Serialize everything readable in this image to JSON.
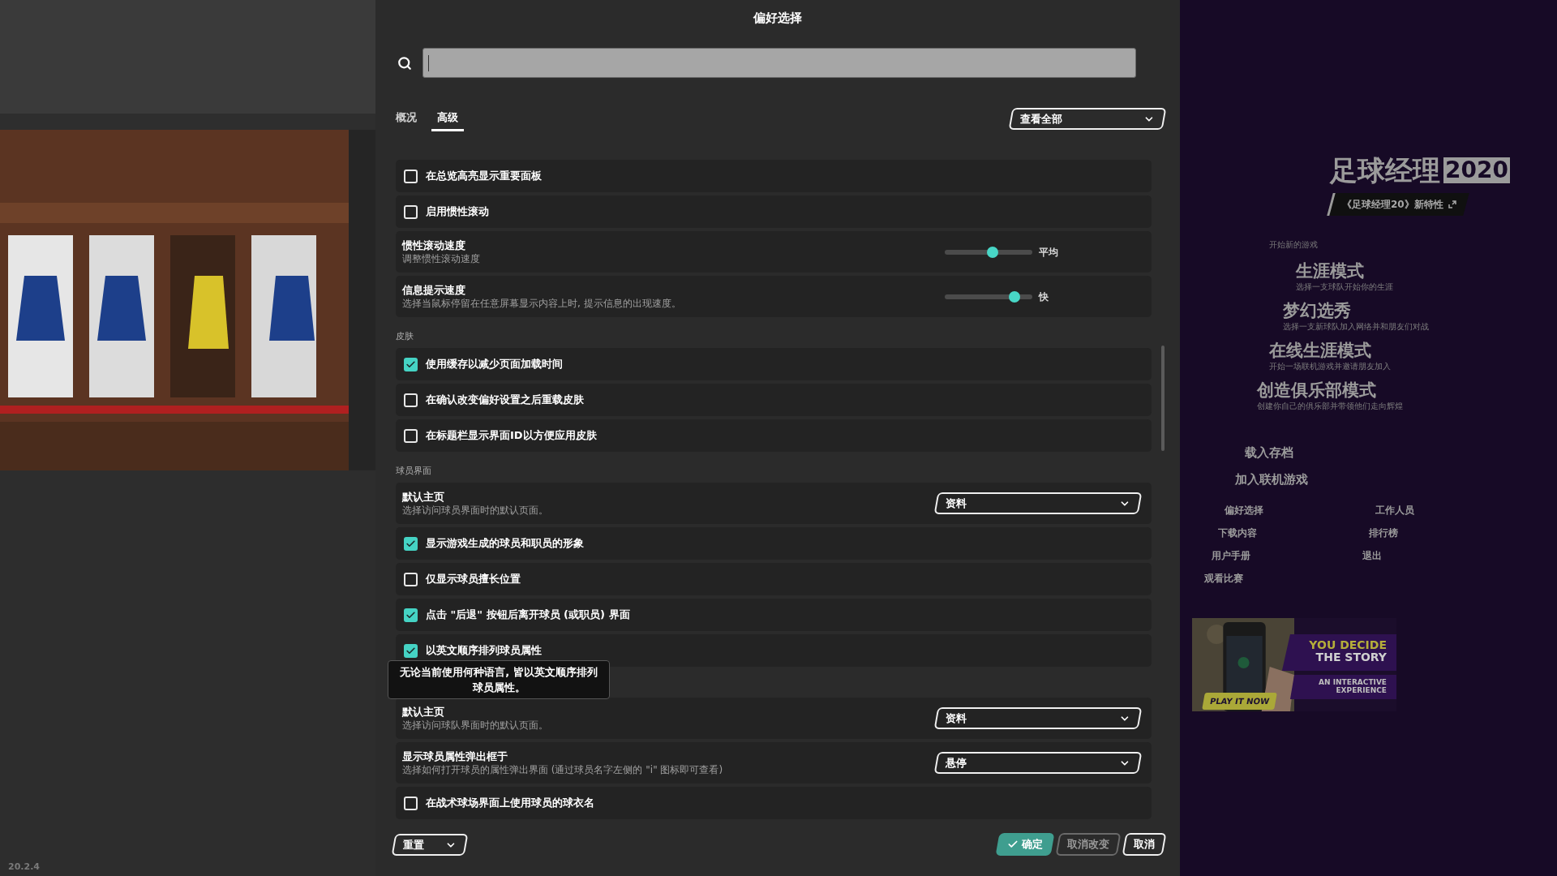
{
  "window": {
    "title": "偏好选择"
  },
  "tabs": [
    {
      "label": "概况",
      "selected": false
    },
    {
      "label": "高级",
      "selected": true
    }
  ],
  "filter": {
    "value": "查看全部"
  },
  "sections": [
    {
      "items": [
        {
          "kind": "checkbox",
          "label": "在总览高亮显示重要面板",
          "checked": false
        },
        {
          "kind": "checkbox",
          "label": "启用惯性滚动",
          "checked": false
        },
        {
          "kind": "slider",
          "label": "惯性滚动速度",
          "description": "调整惯性滚动速度",
          "level": 0.55,
          "reading": "平均"
        },
        {
          "kind": "slider",
          "label": "信息提示速度",
          "description": "选择当鼠标停留在任意屏幕显示内容上时, 提示信息的出现速度。",
          "level": 0.8,
          "reading": "快"
        }
      ]
    },
    {
      "header": "皮肤",
      "items": [
        {
          "kind": "checkbox",
          "label": "使用缓存以减少页面加载时间",
          "checked": true
        },
        {
          "kind": "checkbox",
          "label": "在确认改变偏好设置之后重载皮肤",
          "checked": false
        },
        {
          "kind": "checkbox",
          "label": "在标题栏显示界面ID以方便应用皮肤",
          "checked": false
        }
      ]
    },
    {
      "header": "球员界面",
      "items": [
        {
          "kind": "dropdown",
          "label": "默认主页",
          "description": "选择访问球员界面时的默认页面。",
          "value": "资料"
        },
        {
          "kind": "checkbox",
          "label": "显示游戏生成的球员和职员的形象",
          "checked": true
        },
        {
          "kind": "checkbox",
          "label": "仅显示球员擅长位置",
          "checked": false
        },
        {
          "kind": "checkbox",
          "label": "点击 \"后退\" 按钮后离开球员 (或职员) 界面",
          "checked": true
        },
        {
          "kind": "checkbox",
          "label": "以英文顺序排列球员属性",
          "checked": true
        }
      ]
    },
    {
      "items": [
        {
          "kind": "dropdown",
          "label": "默认主页",
          "description": "选择访问球队界面时的默认页面。",
          "value": "资料"
        },
        {
          "kind": "dropdown",
          "label": "显示球员属性弹出框于",
          "description": "选择如何打开球员的属性弹出界面 (通过球员名字左侧的 \"i\" 图标即可查看)",
          "value": "悬停"
        },
        {
          "kind": "checkbox",
          "label": "在战术球场界面上使用球员的球衣名",
          "checked": false
        }
      ]
    }
  ],
  "tooltip": {
    "text": "无论当前使用何种语言, 皆以英文顺序排列球员属性。"
  },
  "footer": {
    "reset": "重置",
    "buttons": [
      {
        "label": "确定",
        "kind": "confirm",
        "disabled": false
      },
      {
        "label": "取消改变",
        "kind": "plain",
        "disabled": true
      },
      {
        "label": "取消",
        "kind": "plain",
        "disabled": false
      }
    ]
  },
  "version": "20.2.4",
  "home": {
    "logo": {
      "title": "足球经理",
      "year": "2020"
    },
    "whats_new": "《足球经理20》新特性",
    "new_game_label": "开始新的游戏",
    "modes": [
      {
        "title": "生涯模式",
        "subtitle": "选择一支球队开始你的生涯"
      },
      {
        "title": "梦幻选秀",
        "subtitle": "选择一支新球队加入网络并和朋友们对战"
      },
      {
        "title": "在线生涯模式",
        "subtitle": "开始一场联机游戏并邀请朋友加入"
      },
      {
        "title": "创造俱乐部模式",
        "subtitle": "创建你自己的俱乐部并带领他们走向辉煌"
      }
    ],
    "actions": [
      "载入存档",
      "加入联机游戏"
    ],
    "links": [
      "偏好选择",
      "工作人员",
      "下载内容",
      "排行榜",
      "用户手册",
      "退出",
      "观看比赛"
    ]
  },
  "ad": {
    "headline": [
      "YOU DECIDE",
      "THE STORY"
    ],
    "tagline": [
      "AN INTERACTIVE",
      "EXPERIENCE"
    ],
    "cta": "PLAY IT NOW"
  }
}
